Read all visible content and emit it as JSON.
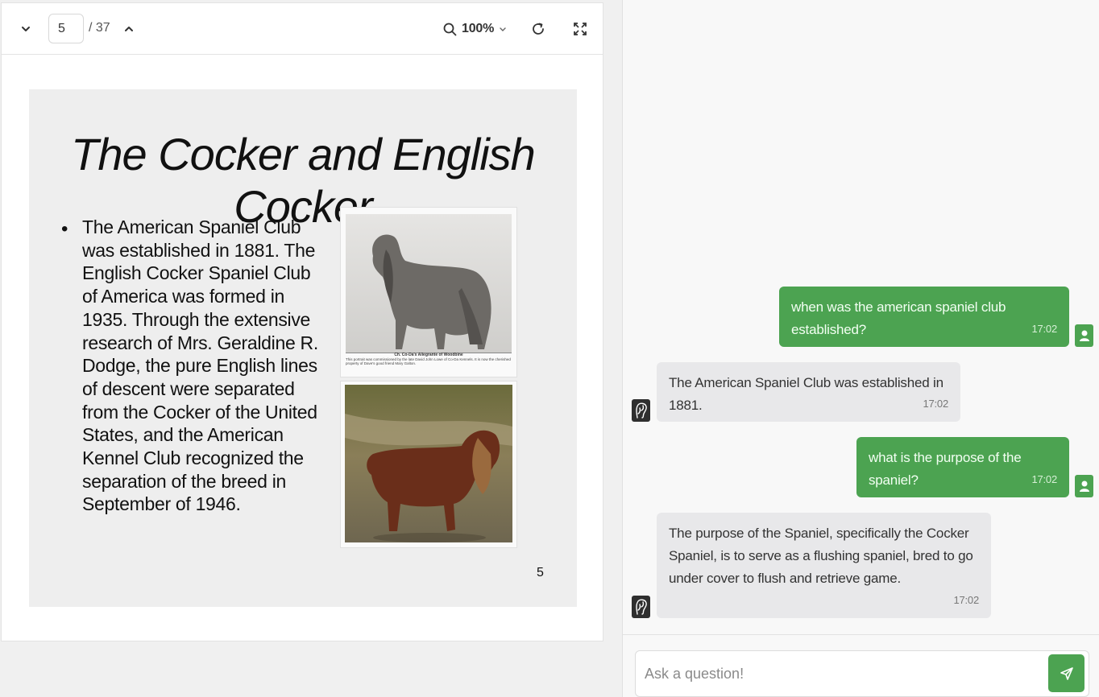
{
  "viewer": {
    "current_page": "5",
    "total_pages": "/ 37",
    "zoom": "100%",
    "icons": {
      "prev": "chevron-down-icon",
      "next": "chevron-up-icon",
      "zoom": "search-icon",
      "zoom_menu": "caret-down-icon",
      "refresh": "refresh-icon",
      "fullscreen": "fullscreen-icon"
    }
  },
  "slide": {
    "title": "The Cocker and English Cocker",
    "bullet": "•",
    "text": "The American Spaniel Club was established in 1881. The English Cocker Spaniel Club of America was formed in 1935. Through the extensive research of Mrs. Geraldine R. Dodge, the pure English lines of descent were separated from the Cocker of the United States, and the American Kennel Club recognized the separation of the breed in September of 1946.",
    "photo1_caption_title": "Ch. Co-Da's Allegrante of Woodbine",
    "photo1_caption_text": "This portrait was commissioned by the late David John Lowe of Co-Da Kennels. It is now the cherished property of Dave's good friend Mary Galton.",
    "page_number": "5"
  },
  "chat": {
    "messages": [
      {
        "role": "user",
        "text": "when was the american spaniel club established?",
        "time": "17:02"
      },
      {
        "role": "bot",
        "text": "The American Spaniel Club was established in 1881.",
        "time": "17:02"
      },
      {
        "role": "user",
        "text": "what is the purpose of the spaniel?",
        "time": "17:02"
      },
      {
        "role": "bot",
        "text": "The purpose of the Spaniel, specifically the Cocker Spaniel, is to serve as a flushing spaniel, bred to go under cover to flush and retrieve game.",
        "time": "17:02"
      }
    ],
    "input_placeholder": "Ask a question!",
    "colors": {
      "user_bubble": "#4ca351",
      "bot_bubble": "#e8e8ea"
    },
    "icons": {
      "user_avatar": "user-icon",
      "bot_avatar": "bot-logo-icon",
      "send": "send-icon"
    }
  }
}
